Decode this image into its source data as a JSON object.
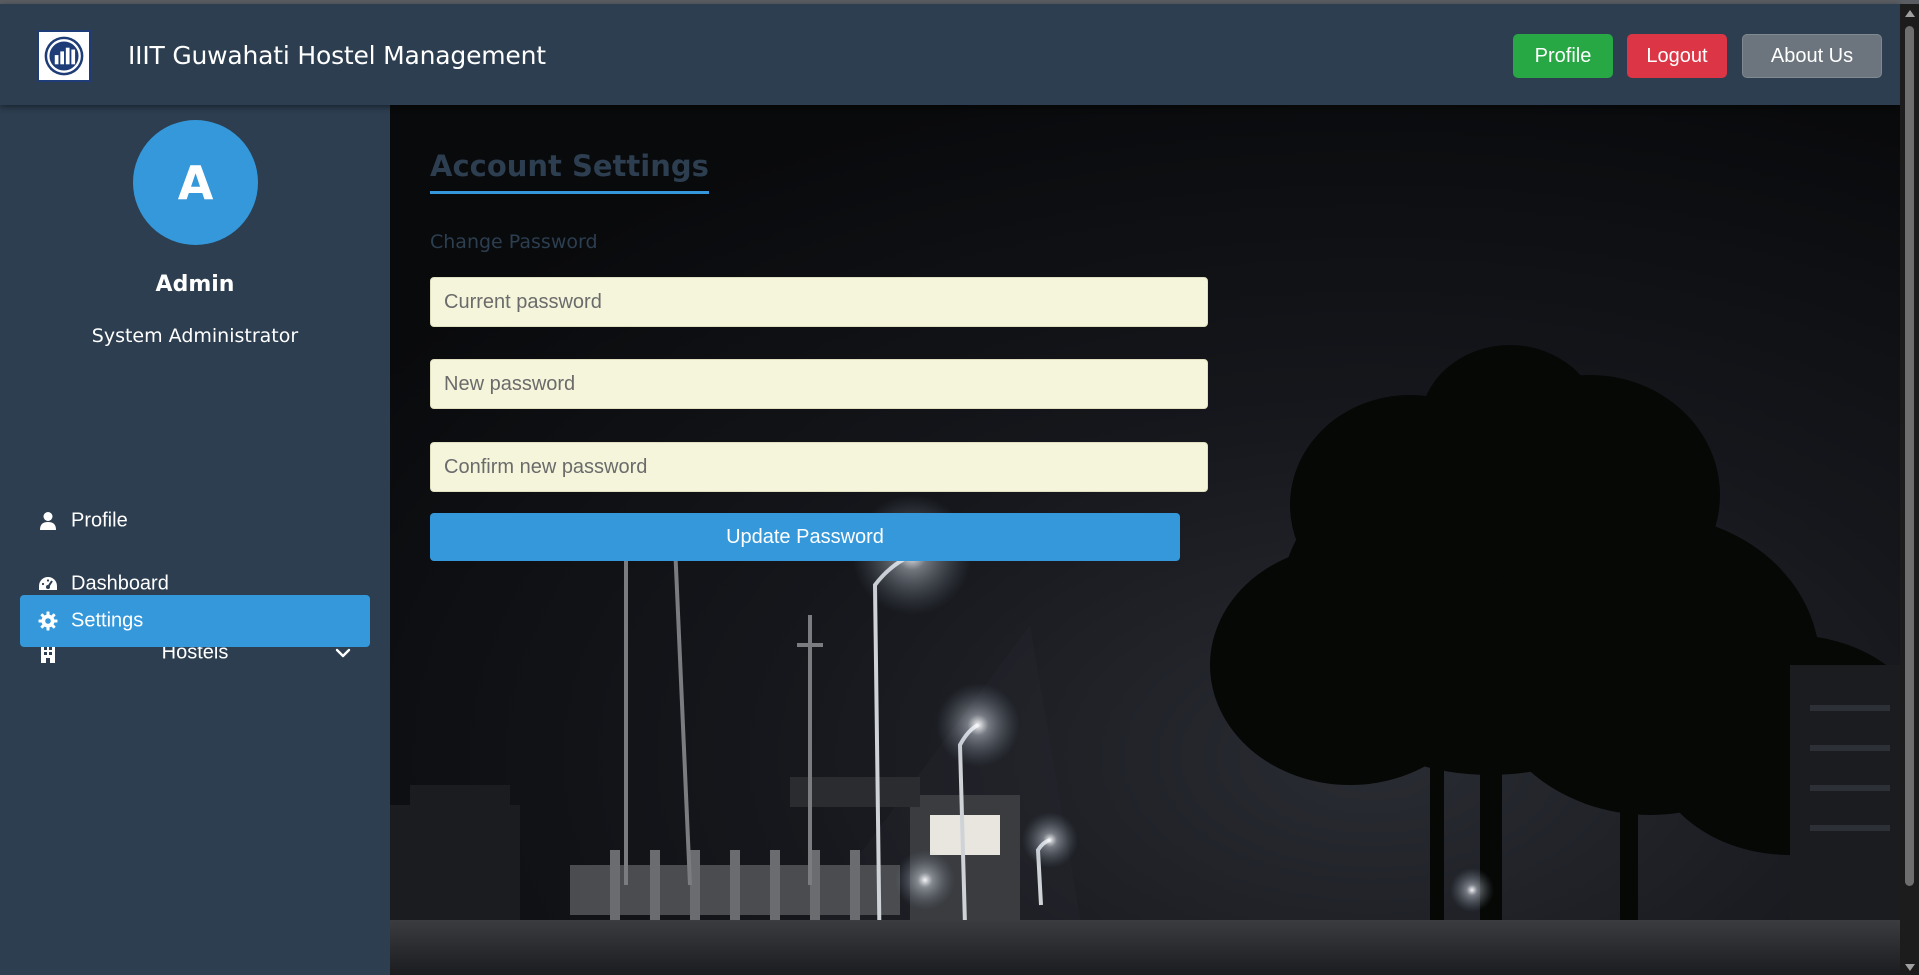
{
  "header": {
    "title": "IIIT Guwahati Hostel Management",
    "logo_icon": "building-logo-icon",
    "buttons": {
      "profile": "Profile",
      "logout": "Logout",
      "about": "About Us"
    }
  },
  "sidebar": {
    "avatar_letter": "A",
    "user_name": "Admin",
    "user_role": "System Administrator",
    "items": [
      {
        "label": "Profile",
        "icon": "user-icon",
        "active": false
      },
      {
        "label": "Dashboard",
        "icon": "gauge-icon",
        "active": false
      },
      {
        "label": "Hostels",
        "icon": "building-icon",
        "active": false,
        "expandable": true
      },
      {
        "label": "Settings",
        "icon": "gear-icon",
        "active": true
      }
    ]
  },
  "main": {
    "title": "Account Settings",
    "subtitle": "Change Password",
    "fields": [
      {
        "placeholder": "Current password",
        "value": ""
      },
      {
        "placeholder": "New password",
        "value": ""
      },
      {
        "placeholder": "Confirm new password",
        "value": ""
      }
    ],
    "submit_label": "Update Password"
  },
  "colors": {
    "header_bg": "#2c3e50",
    "accent": "#3498db",
    "success": "#28a745",
    "danger": "#dc3545",
    "secondary": "#6c757d",
    "input_bg": "#f5f5dc"
  }
}
